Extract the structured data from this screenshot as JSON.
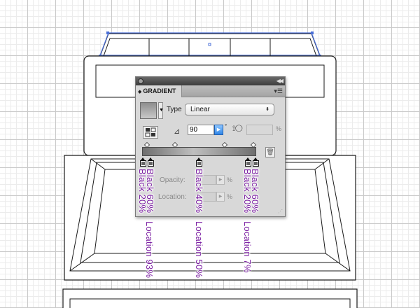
{
  "colors": {
    "accent": "#2f86e8",
    "annotation": "#7b1fa2",
    "selection": "#4a6fd8"
  },
  "panel": {
    "tab_title": "GRADIENT",
    "type_label": "Type",
    "type_value": "Linear",
    "angle_value": "90",
    "degree_symbol": "°",
    "aspect_unit": "%",
    "opacity_label": "Opacity:",
    "location_label": "Location:",
    "percent_symbol": "%",
    "icons": [
      "close-icon",
      "collapse-icon",
      "panel-menu-icon",
      "reverse-gradient-icon",
      "angle-icon",
      "aspect-ratio-icon",
      "trash-icon",
      "resize-grip-icon"
    ]
  },
  "gradient_stops": [
    {
      "color": "Black 60%",
      "location": 0
    },
    {
      "color": "Black 20%",
      "location": 7
    },
    {
      "color": "Black 40%",
      "location": 50
    },
    {
      "color": "Black 20%",
      "location": 93
    },
    {
      "color": "Black 60%",
      "location": 100
    }
  ],
  "annotations": {
    "left_top": "Black 20%",
    "left_bottom": "Black 60%",
    "left_location": "Location 93%",
    "center": "Black 40%",
    "center_location": "Location 50%",
    "right_top": "Black 60%",
    "right_bottom": "Black 20%",
    "right_location": "Location 7%"
  }
}
